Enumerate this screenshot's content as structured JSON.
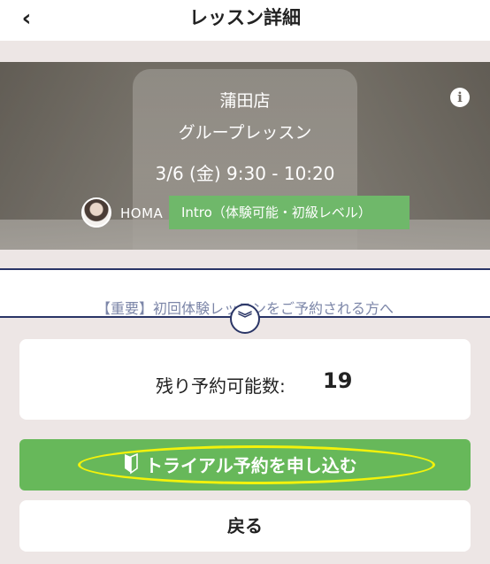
{
  "header": {
    "back_icon": "‹",
    "title": "レッスン詳細"
  },
  "lesson": {
    "info_icon": "i",
    "store": "蒲田店",
    "type": "グループレッスン",
    "datetime": "3/6 (金) 9:30 - 10:20",
    "instructor": "HOMA",
    "level": "Intro（体験可能・初級レベル）"
  },
  "notice": {
    "text": "【重要】初回体験レッスンをご予約される方へ",
    "expand_icon": "︾"
  },
  "remaining": {
    "label": "残り予約可能数:",
    "count": "19"
  },
  "actions": {
    "trial_label": "トライアル予約を申し込む",
    "back_label": "戻る"
  },
  "colors": {
    "accent_green": "#67b85a",
    "badge_green": "#6fb86a",
    "navy": "#2a3566",
    "highlight_yellow": "#f3f20b",
    "background": "#ede6e5"
  }
}
